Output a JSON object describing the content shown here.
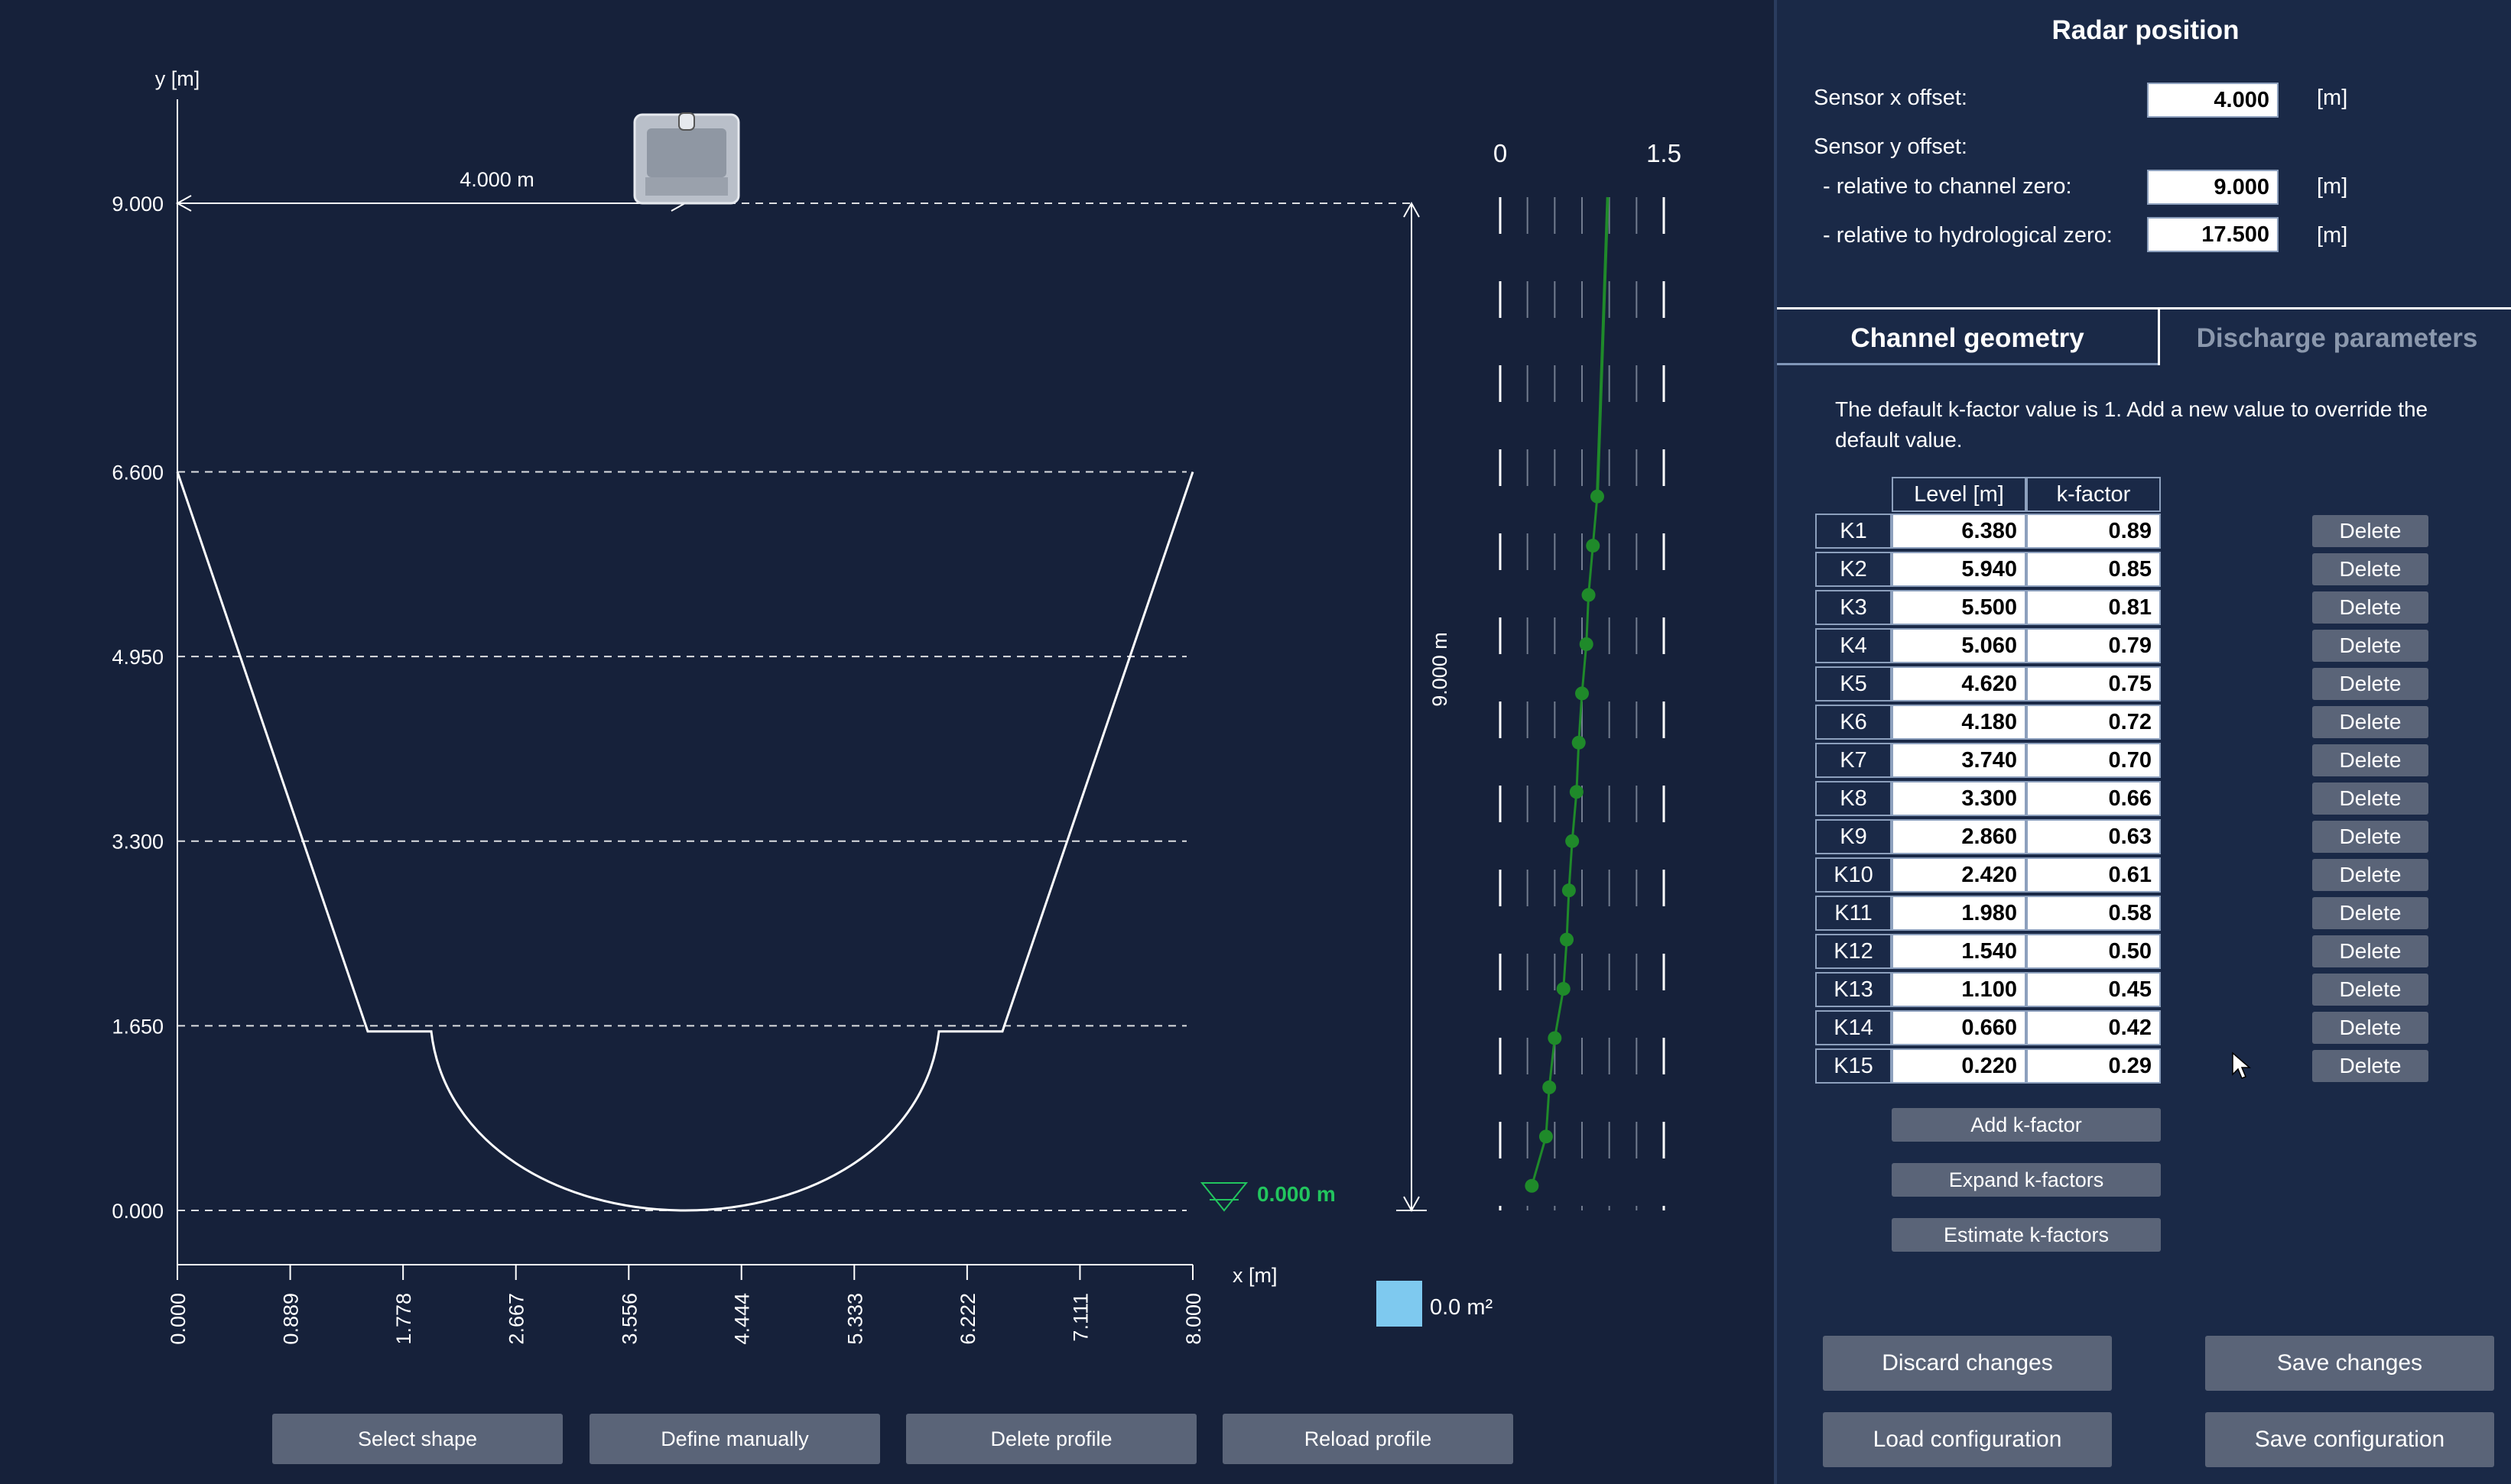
{
  "chart_data": {
    "type": "line",
    "title": "",
    "xlabel": "x [m]",
    "ylabel": "y [m]",
    "xlim": [
      0,
      8
    ],
    "ylim": [
      0,
      9
    ],
    "x_ticks": [
      "0.000",
      "0.889",
      "1.778",
      "2.667",
      "3.556",
      "4.444",
      "5.333",
      "6.222",
      "7.111",
      "8.000"
    ],
    "y_ticks": [
      "9.000",
      "6.600",
      "4.950",
      "3.300",
      "1.650",
      "0.000"
    ],
    "profile": [
      {
        "x": 0.0,
        "y": 6.6
      },
      {
        "x": 1.5,
        "y": 1.6
      },
      {
        "x": 2.0,
        "y": 1.6
      },
      {
        "x": 4.0,
        "y": 0.0
      },
      {
        "x": 6.0,
        "y": 1.6
      },
      {
        "x": 6.5,
        "y": 1.6
      },
      {
        "x": 8.0,
        "y": 6.6
      }
    ],
    "sensor_x": 4.0,
    "sensor_y": 9.0,
    "sensor_offset_label": "4.000 m",
    "height_label": "9.000 m",
    "water_level_label": "0.000 m",
    "area_label": "0.0 m²",
    "kfactor_axis": [
      "0",
      "1.5"
    ],
    "kfactor_range": [
      0,
      1.5
    ]
  },
  "colors": {
    "accent_green": "#22c55e",
    "area_blue": "#7ec9ef"
  },
  "icons": {
    "sensor": "radar-sensor-icon",
    "water": "water-level-triangle-icon",
    "cursor": "mouse-pointer-icon"
  },
  "radar": {
    "title": "Radar position",
    "x_offset_label": "Sensor x offset:",
    "x_offset_value": "4.000",
    "y_offset_label": "Sensor y offset:",
    "rel_channel_label": "- relative to channel zero:",
    "rel_channel_value": "9.000",
    "rel_hydro_label": "- relative to hydrological zero:",
    "rel_hydro_value": "17.500",
    "unit": "[m]"
  },
  "tabs": {
    "active": "Channel geometry",
    "inactive": "Discharge parameters"
  },
  "info_text": "The default k-factor value is 1. Add a new value to override the default value.",
  "kfactor_table": {
    "headers": [
      "Level [m]",
      "k-factor"
    ],
    "delete_label": "Delete",
    "rows": [
      {
        "id": "K1",
        "level": "6.380",
        "k": "0.89"
      },
      {
        "id": "K2",
        "level": "5.940",
        "k": "0.85"
      },
      {
        "id": "K3",
        "level": "5.500",
        "k": "0.81"
      },
      {
        "id": "K4",
        "level": "5.060",
        "k": "0.79"
      },
      {
        "id": "K5",
        "level": "4.620",
        "k": "0.75"
      },
      {
        "id": "K6",
        "level": "4.180",
        "k": "0.72"
      },
      {
        "id": "K7",
        "level": "3.740",
        "k": "0.70"
      },
      {
        "id": "K8",
        "level": "3.300",
        "k": "0.66"
      },
      {
        "id": "K9",
        "level": "2.860",
        "k": "0.63"
      },
      {
        "id": "K10",
        "level": "2.420",
        "k": "0.61"
      },
      {
        "id": "K11",
        "level": "1.980",
        "k": "0.58"
      },
      {
        "id": "K12",
        "level": "1.540",
        "k": "0.50"
      },
      {
        "id": "K13",
        "level": "1.100",
        "k": "0.45"
      },
      {
        "id": "K14",
        "level": "0.660",
        "k": "0.42"
      },
      {
        "id": "K15",
        "level": "0.220",
        "k": "0.29"
      }
    ]
  },
  "kbuttons": {
    "add": "Add k-factor",
    "expand": "Expand k-factors",
    "estimate": "Estimate k-factors"
  },
  "actions": {
    "discard": "Discard changes",
    "save": "Save changes",
    "load_config": "Load configuration",
    "save_config": "Save configuration"
  },
  "profile_buttons": {
    "select_shape": "Select shape",
    "define_manually": "Define manually",
    "delete_profile": "Delete profile",
    "reload_profile": "Reload profile"
  }
}
